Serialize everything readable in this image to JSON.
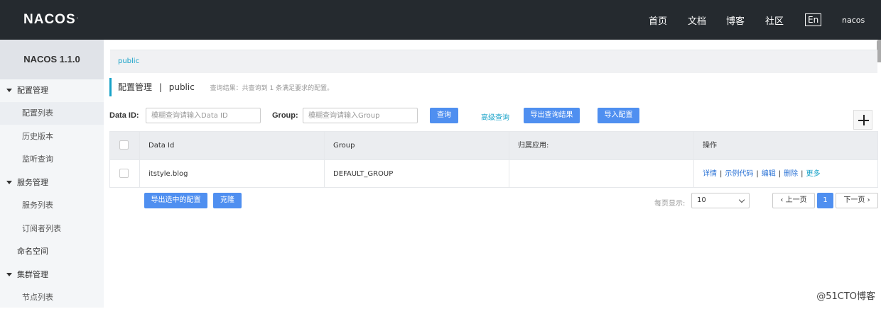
{
  "header": {
    "logo": "NACOS",
    "logo_mark": ".",
    "nav": [
      "首页",
      "文档",
      "博客",
      "社区"
    ],
    "lang": "En",
    "user": "nacos"
  },
  "sidebar": {
    "title": "NACOS 1.1.0",
    "groups": {
      "config": {
        "label": "配置管理",
        "items": [
          "配置列表",
          "历史版本",
          "监听查询"
        ]
      },
      "service": {
        "label": "服务管理",
        "items": [
          "服务列表",
          "订阅者列表"
        ]
      },
      "namespace": "命名空间",
      "cluster": {
        "label": "集群管理",
        "items": [
          "节点列表"
        ]
      }
    }
  },
  "breadcrumb": "public",
  "page": {
    "title": "配置管理",
    "separator": "|",
    "namespace": "public",
    "hint": "查询结果：共查询到 1 条满足要求的配置。"
  },
  "search": {
    "data_id_label": "Data ID:",
    "data_id_placeholder": "模糊查询请输入Data ID",
    "group_label": "Group:",
    "group_placeholder": "模糊查询请输入Group",
    "query_btn": "查询",
    "advanced_link": "高级查询",
    "export_btn": "导出查询结果",
    "import_btn": "导入配置"
  },
  "table": {
    "columns": [
      "Data Id",
      "Group",
      "归属应用:",
      "操作"
    ],
    "rows": [
      {
        "data_id": "itstyle.blog",
        "group": "DEFAULT_GROUP",
        "app": "",
        "ops": [
          "详情",
          "示例代码",
          "编辑",
          "删除",
          "更多"
        ]
      }
    ]
  },
  "footer_actions": {
    "export_selected": "导出选中的配置",
    "clone": "克隆"
  },
  "pagination": {
    "per_page_label": "每页显示:",
    "per_page_value": "10",
    "prev": "上一页",
    "current": "1",
    "next": "下一页"
  },
  "watermark": "@51CTO博客"
}
